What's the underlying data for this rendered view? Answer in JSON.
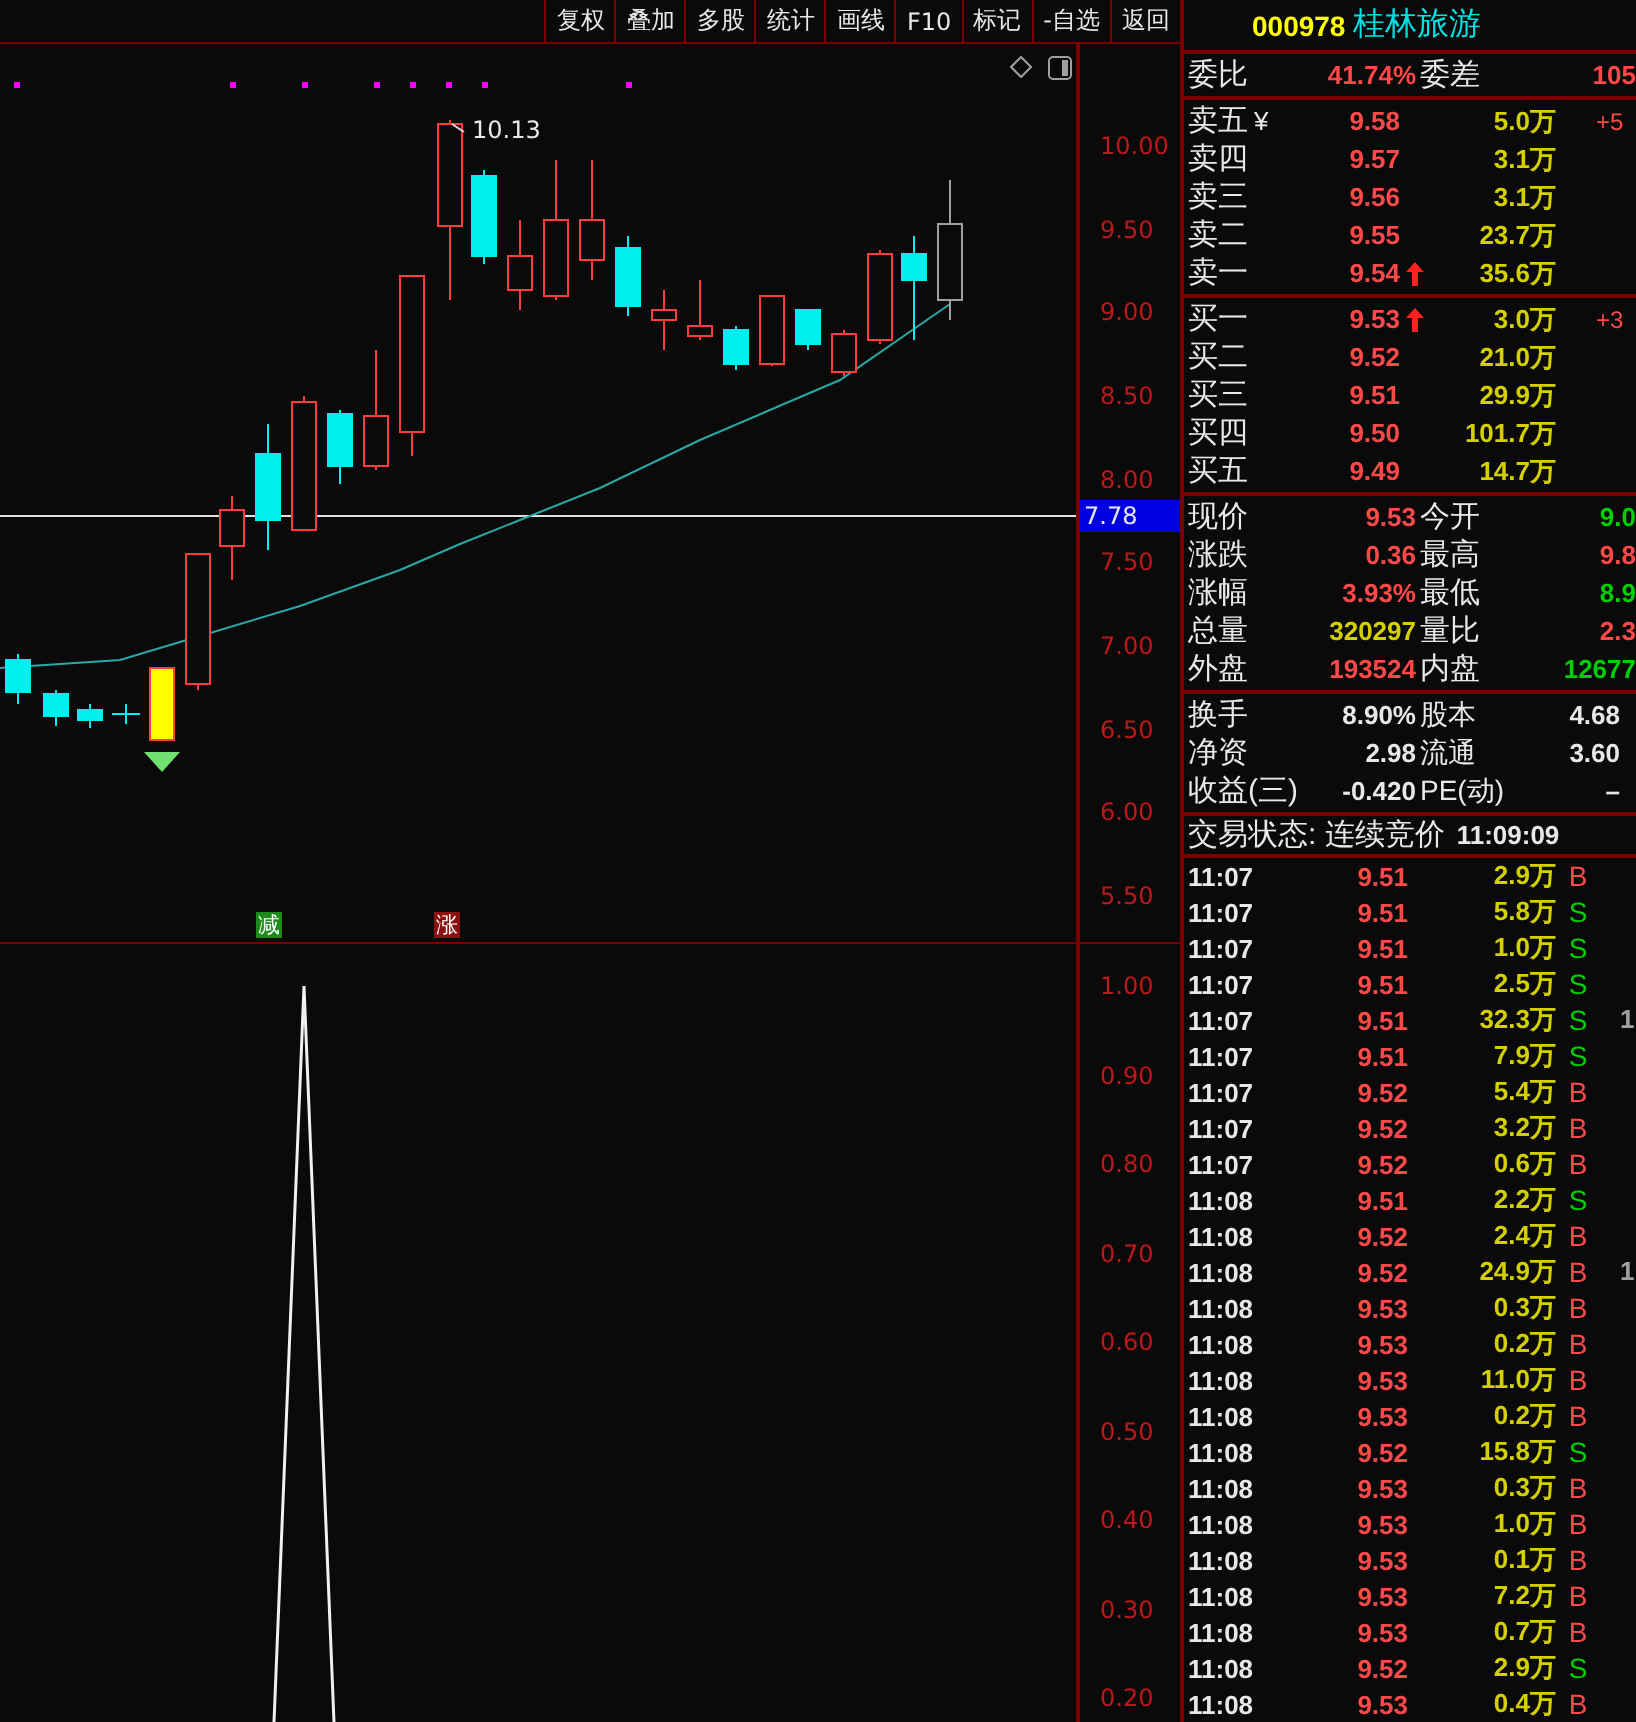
{
  "toolbar": [
    {
      "label": "复权"
    },
    {
      "label": "叠加"
    },
    {
      "label": "多股"
    },
    {
      "label": "统计"
    },
    {
      "label": "画线"
    },
    {
      "label": "F10"
    },
    {
      "label": "标记"
    },
    {
      "label": "-自选"
    },
    {
      "label": "返回"
    }
  ],
  "price_chart": {
    "high_label": "10.13",
    "last_label": "7.78",
    "axis": [
      "10.00",
      "9.50",
      "9.00",
      "8.50",
      "8.00",
      "7.50",
      "7.00",
      "6.50",
      "6.00",
      "5.50"
    ],
    "signals": [
      {
        "label": "减",
        "color": "#1a8a1a"
      },
      {
        "label": "涨",
        "color": "#8c1010"
      }
    ]
  },
  "indicator_chart": {
    "axis": [
      "1.00",
      "0.90",
      "0.80",
      "0.70",
      "0.60",
      "0.50",
      "0.40",
      "0.30",
      "0.20"
    ]
  },
  "quote": {
    "code": "000978",
    "name": "桂林旅游",
    "ratio_label": "委比",
    "ratio": "41.74%",
    "diff_label": "委差",
    "diff": "105",
    "asks": [
      {
        "label": "卖五",
        "symbol": "¥",
        "price": "9.58",
        "volume": "5.0万",
        "change": "+5",
        "up_arrow": false
      },
      {
        "label": "卖四",
        "price": "9.57",
        "volume": "3.1万",
        "up_arrow": false
      },
      {
        "label": "卖三",
        "price": "9.56",
        "volume": "3.1万",
        "up_arrow": false
      },
      {
        "label": "卖二",
        "price": "9.55",
        "volume": "23.7万",
        "up_arrow": false
      },
      {
        "label": "卖一",
        "price": "9.54",
        "volume": "35.6万",
        "up_arrow": true
      }
    ],
    "bids": [
      {
        "label": "买一",
        "price": "9.53",
        "volume": "3.0万",
        "change": "+3",
        "up_arrow": true
      },
      {
        "label": "买二",
        "price": "9.52",
        "volume": "21.0万",
        "up_arrow": false
      },
      {
        "label": "买三",
        "price": "9.51",
        "volume": "29.9万",
        "up_arrow": false
      },
      {
        "label": "买四",
        "price": "9.50",
        "volume": "101.7万",
        "up_arrow": false
      },
      {
        "label": "买五",
        "price": "9.49",
        "volume": "14.7万",
        "up_arrow": false
      }
    ],
    "stats": [
      {
        "label": "现价",
        "value": "9.53",
        "color": "#ff4848"
      },
      {
        "label": "今开",
        "value": "9.0",
        "color": "#00d000"
      },
      {
        "label": "涨跌",
        "value": "0.36",
        "color": "#ff4848"
      },
      {
        "label": "最高",
        "value": "9.8",
        "color": "#ff4848"
      },
      {
        "label": "涨幅",
        "value": "3.93%",
        "color": "#ff4848"
      },
      {
        "label": "最低",
        "value": "8.9",
        "color": "#00d000"
      },
      {
        "label": "总量",
        "value": "320297",
        "color": "#d4d000"
      },
      {
        "label": "量比",
        "value": "2.3",
        "color": "#ff4848"
      },
      {
        "label": "外盘",
        "value": "193524",
        "color": "#ff4848"
      },
      {
        "label": "内盘",
        "value": "12677",
        "color": "#00d000"
      }
    ],
    "fundamentals": [
      {
        "label": "换手",
        "value": "8.90%",
        "label2": "股本",
        "value2": "4.68"
      },
      {
        "label": "净资",
        "value": "2.98",
        "label2": "流通",
        "value2": "3.60"
      },
      {
        "label": "收益(三)",
        "value": "-0.420",
        "label2": "PE(动)",
        "value2": "–"
      }
    ],
    "status": "交易状态: 连续竞价",
    "status_time": "11:09:09",
    "trades": [
      {
        "time": "11:07",
        "price": "9.51",
        "volume": "2.9万",
        "side": "B",
        "kind": "buy"
      },
      {
        "time": "11:07",
        "price": "9.51",
        "volume": "5.8万",
        "side": "S",
        "kind": "sell"
      },
      {
        "time": "11:07",
        "price": "9.51",
        "volume": "1.0万",
        "side": "S",
        "kind": "sell"
      },
      {
        "time": "11:07",
        "price": "9.51",
        "volume": "2.5万",
        "side": "S",
        "kind": "sell"
      },
      {
        "time": "11:07",
        "price": "9.51",
        "volume": "32.3万",
        "side": "S",
        "kind": "sell",
        "extra": "1"
      },
      {
        "time": "11:07",
        "price": "9.51",
        "volume": "7.9万",
        "side": "S",
        "kind": "sell"
      },
      {
        "time": "11:07",
        "price": "9.52",
        "volume": "5.4万",
        "side": "B",
        "kind": "buy"
      },
      {
        "time": "11:07",
        "price": "9.52",
        "volume": "3.2万",
        "side": "B",
        "kind": "buy"
      },
      {
        "time": "11:07",
        "price": "9.52",
        "volume": "0.6万",
        "side": "B",
        "kind": "buy"
      },
      {
        "time": "11:08",
        "price": "9.51",
        "volume": "2.2万",
        "side": "S",
        "kind": "sell"
      },
      {
        "time": "11:08",
        "price": "9.52",
        "volume": "2.4万",
        "side": "B",
        "kind": "buy"
      },
      {
        "time": "11:08",
        "price": "9.52",
        "volume": "24.9万",
        "side": "B",
        "kind": "buy",
        "extra": "1"
      },
      {
        "time": "11:08",
        "price": "9.53",
        "volume": "0.3万",
        "side": "B",
        "kind": "buy"
      },
      {
        "time": "11:08",
        "price": "9.53",
        "volume": "0.2万",
        "side": "B",
        "kind": "buy"
      },
      {
        "time": "11:08",
        "price": "9.53",
        "volume": "11.0万",
        "side": "B",
        "kind": "buy"
      },
      {
        "time": "11:08",
        "price": "9.53",
        "volume": "0.2万",
        "side": "B",
        "kind": "buy"
      },
      {
        "time": "11:08",
        "price": "9.52",
        "volume": "15.8万",
        "side": "S",
        "kind": "sell"
      },
      {
        "time": "11:08",
        "price": "9.53",
        "volume": "0.3万",
        "side": "B",
        "kind": "buy"
      },
      {
        "time": "11:08",
        "price": "9.53",
        "volume": "1.0万",
        "side": "B",
        "kind": "buy"
      },
      {
        "time": "11:08",
        "price": "9.53",
        "volume": "0.1万",
        "side": "B",
        "kind": "buy"
      },
      {
        "time": "11:08",
        "price": "9.53",
        "volume": "7.2万",
        "side": "B",
        "kind": "buy"
      },
      {
        "time": "11:08",
        "price": "9.53",
        "volume": "0.7万",
        "side": "B",
        "kind": "buy"
      },
      {
        "time": "11:08",
        "price": "9.52",
        "volume": "2.9万",
        "side": "S",
        "kind": "sell"
      },
      {
        "time": "11:08",
        "price": "9.53",
        "volume": "0.4万",
        "side": "B",
        "kind": "buy"
      }
    ]
  }
}
